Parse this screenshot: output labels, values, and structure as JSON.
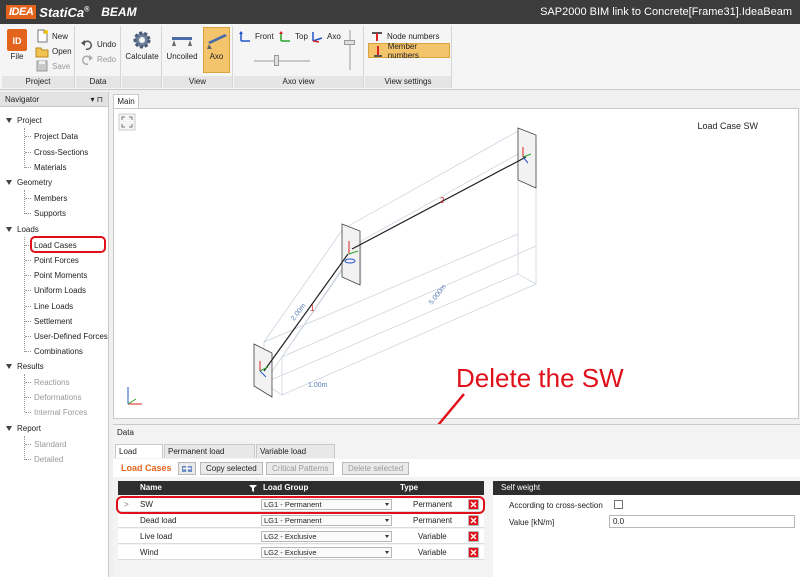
{
  "titlebar": {
    "logo_box": "IDEA",
    "logo_text": "StatiCa",
    "logo_reg": "®",
    "app_name": "BEAM",
    "window_title": "SAP2000 BIM link to Concrete[Frame31].IdeaBeam"
  },
  "ribbon": {
    "project": {
      "file": "File",
      "new": "New",
      "open": "Open",
      "save": "Save",
      "label": "Project"
    },
    "data": {
      "undo": "Undo",
      "redo": "Redo",
      "label": "Data"
    },
    "calculate": "Calculate",
    "view": {
      "uncoiled": "Uncoiled",
      "axo": "Axo",
      "label": "View"
    },
    "axo_view": {
      "front": "Front",
      "top": "Top",
      "axo": "Axo",
      "label": "Axo view"
    },
    "view_settings": {
      "node_numbers": "Node numbers",
      "member_numbers": "Member numbers",
      "label": "View settings"
    }
  },
  "navigator": {
    "title": "Navigator",
    "pin": "▾ ⊓",
    "sections": [
      {
        "label": "Project",
        "items": [
          "Project Data",
          "Cross-Sections",
          "Materials"
        ]
      },
      {
        "label": "Geometry",
        "items": [
          "Members",
          "Supports"
        ]
      },
      {
        "label": "Loads",
        "items": [
          "Load Cases",
          "Point Forces",
          "Point Moments",
          "Uniform Loads",
          "Line Loads",
          "Settlement",
          "User-Defined Forces",
          "Combinations"
        ]
      },
      {
        "label": "Results",
        "items": [
          "Reactions",
          "Deformations",
          "Internal Forces"
        ]
      },
      {
        "label": "Report",
        "items": [
          "Standard",
          "Detailed"
        ]
      }
    ]
  },
  "main": {
    "tab": "Main",
    "load_case_label": "Load Case SW",
    "member_labels": [
      "1",
      "2"
    ],
    "dimensions": [
      "1.00m",
      "2.00m",
      "5.000m"
    ]
  },
  "data_panel": {
    "title": "Data",
    "tabs": [
      "Load cases",
      "Permanent load groups",
      "Variable load groups"
    ],
    "section_title": "Load Cases",
    "buttons": {
      "copy": "Copy selected",
      "critical": "Critical Patterns",
      "delete": "Delete selected"
    },
    "columns": [
      "Name",
      "Load Group",
      "Type"
    ],
    "rows": [
      {
        "name": "SW",
        "group": "LG1 - Permanent",
        "type": "Permanent"
      },
      {
        "name": "Dead load",
        "group": "LG1 - Permanent",
        "type": "Permanent"
      },
      {
        "name": "Live load",
        "group": "LG2 - Exclusive",
        "type": "Variable"
      },
      {
        "name": "Wind",
        "group": "LG2 - Exclusive",
        "type": "Variable"
      }
    ],
    "self_weight": {
      "title": "Self weight",
      "according": "According to cross-section",
      "value_label": "Value [kN/m]",
      "value": "0.0"
    }
  },
  "annotation": {
    "text": "Delete the SW"
  },
  "colors": {
    "accent": "#e3651d",
    "highlight": "#e0101a",
    "active": "#f4c46d"
  }
}
